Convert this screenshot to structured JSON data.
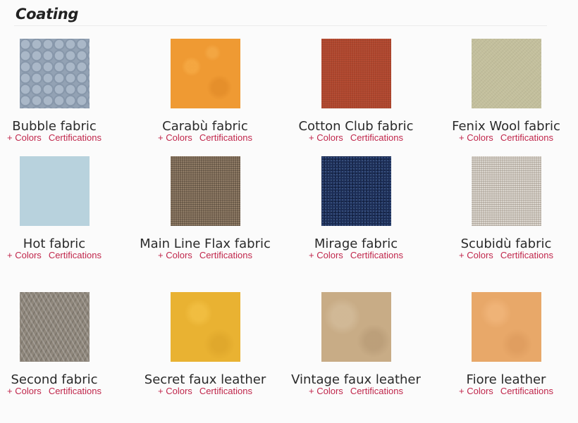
{
  "section": {
    "title": "Coating"
  },
  "links": {
    "colors": "+ Colors",
    "certifications": "Certifications"
  },
  "fabrics": [
    {
      "name": "Bubble fabric",
      "texture": "bubble",
      "color": "#93a2b4"
    },
    {
      "name": "Carabù fabric",
      "texture": "carabu",
      "color": "#ef9a33"
    },
    {
      "name": "Cotton Club fabric",
      "texture": "cotton",
      "color": "#b0462d"
    },
    {
      "name": "Fenix Wool fabric",
      "texture": "fenix",
      "color": "#c3bf9c"
    },
    {
      "name": "Hot fabric",
      "texture": "hot",
      "color": "#b8d2dd"
    },
    {
      "name": "Main Line Flax fabric",
      "texture": "mainline",
      "color": "#7d6a56"
    },
    {
      "name": "Mirage fabric",
      "texture": "mirage",
      "color": "#1b2c55"
    },
    {
      "name": "Scubidù fabric",
      "texture": "scubidu",
      "color": "#cdc6bc"
    },
    {
      "name": "Second fabric",
      "texture": "second",
      "color": "#8f877c"
    },
    {
      "name": "Secret faux leather",
      "texture": "secret",
      "color": "#e9b232"
    },
    {
      "name": "Vintage faux leather",
      "texture": "vintage",
      "color": "#c8ac86"
    },
    {
      "name": "Fiore leather",
      "texture": "fiore",
      "color": "#e8a869"
    }
  ],
  "accent_color": "#c0264b"
}
